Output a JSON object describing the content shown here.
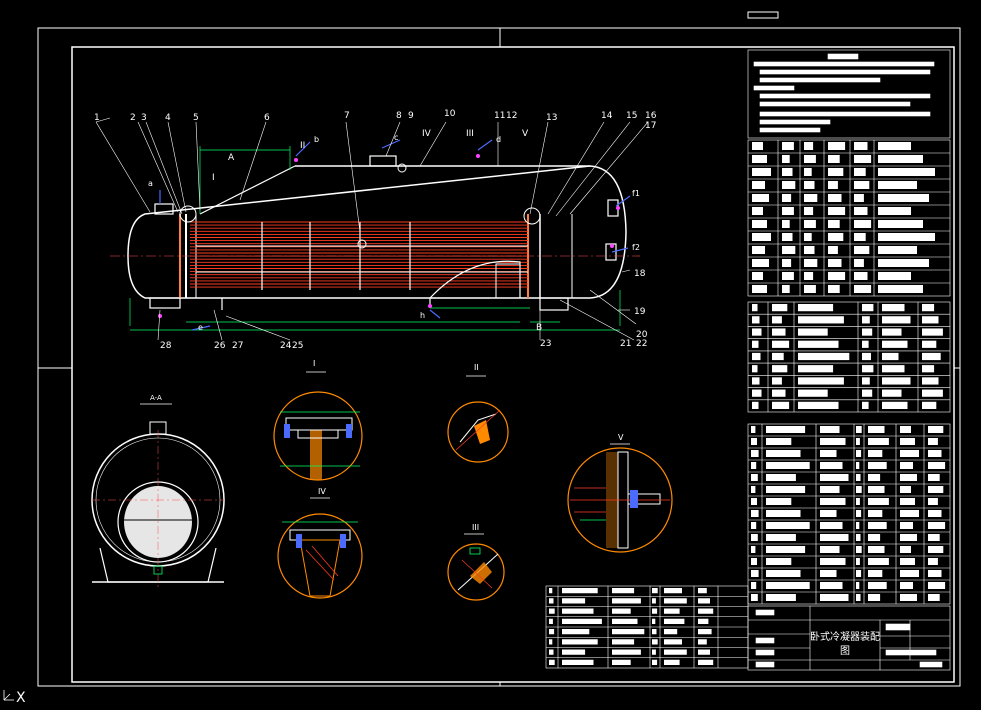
{
  "colors": {
    "background": "#000000",
    "line": "#ffffff",
    "tube": "#ff3b1f",
    "tubesheet": "#ff8040",
    "leader": "#ffff00",
    "dim": "#00ff66",
    "center": "#ff5050",
    "accent_blue": "#4b6bff",
    "accent_orange": "#ff8a00",
    "magenta": "#ff44ff"
  },
  "callouts": {
    "part_numbers_top": [
      "1",
      "2",
      "3",
      "4",
      "5",
      "6",
      "7",
      "8",
      "9",
      "10",
      "11",
      "12",
      "13",
      "14",
      "15",
      "16",
      "17"
    ],
    "part_numbers_right": [
      "18",
      "19",
      "20",
      "21",
      "22"
    ],
    "part_numbers_bottom": [
      "28",
      "26",
      "27",
      "24",
      "25",
      "23"
    ],
    "section_marks": [
      "I",
      "II",
      "III",
      "IV",
      "V"
    ],
    "nozzles": [
      "a",
      "b",
      "c",
      "d",
      "e",
      "f1",
      "f2",
      "h"
    ],
    "section_a": "A",
    "section_b": "B"
  },
  "details": {
    "view_aa": "A-A",
    "detail_1": "I",
    "detail_2": "II",
    "detail_3": "III",
    "detail_4": "IV",
    "detail_5": "V"
  },
  "title_block": {
    "drawing_title_1": "卧式冷凝器装配",
    "drawing_title_2": "图"
  },
  "ucs_icon_label": "X"
}
